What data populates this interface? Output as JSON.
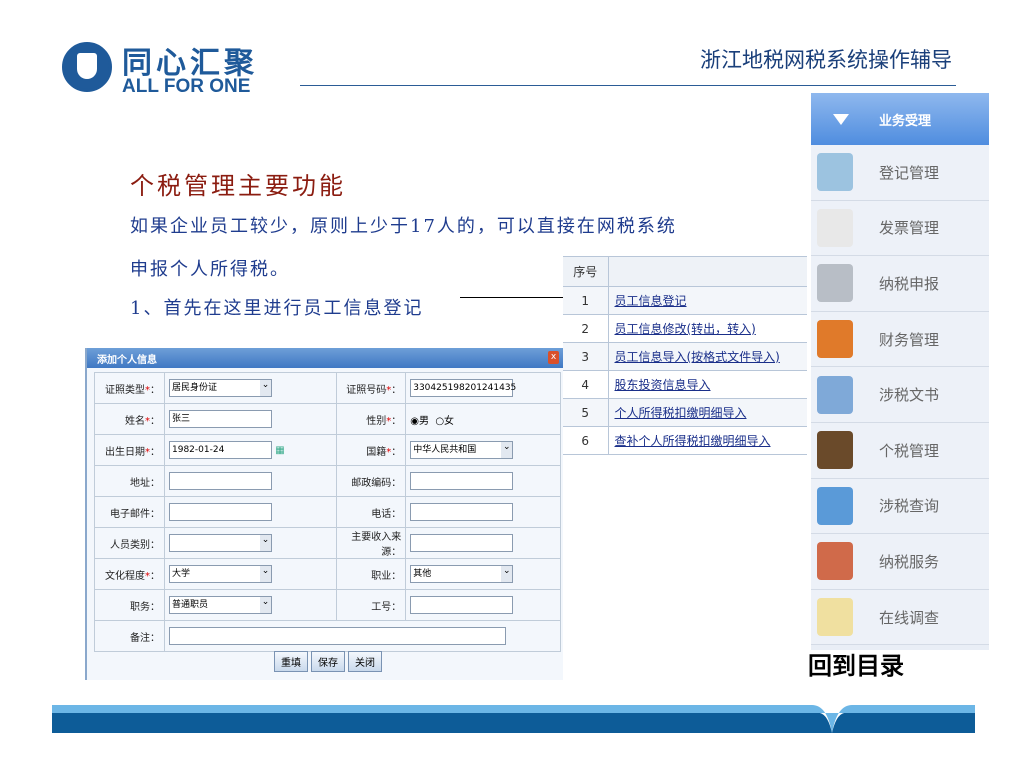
{
  "header": {
    "logo_cn": "同心汇聚",
    "logo_en": "ALL FOR ONE",
    "title": "浙江地税网税系统操作辅导"
  },
  "main": {
    "heading": "个税管理主要功能",
    "lines": [
      "如果企业员工较少，原则上少于17人的，可以直接在网税系统",
      "申报个人所得税。",
      "1、首先在这里进行员工信息登记"
    ]
  },
  "table": {
    "header": "序号",
    "rows": [
      {
        "n": "1",
        "label": "员工信息登记"
      },
      {
        "n": "2",
        "label": "员工信息修改(转出，转入)"
      },
      {
        "n": "3",
        "label": "员工信息导入(按格式文件导入)"
      },
      {
        "n": "4",
        "label": "股东投资信息导入"
      },
      {
        "n": "5",
        "label": "个人所得税扣缴明细导入"
      },
      {
        "n": "6",
        "label": "查补个人所得税扣缴明细导入"
      }
    ]
  },
  "sidebar": {
    "header": "业务受理",
    "items": [
      "登记管理",
      "发票管理",
      "纳税申报",
      "财务管理",
      "涉税文书",
      "个税管理",
      "涉税查询",
      "纳税服务",
      "在线调查"
    ],
    "icon_colors": [
      "#9cc3e0",
      "#e8e8e8",
      "#b8bec6",
      "#e07a2a",
      "#7fa9d8",
      "#6a4a2a",
      "#5a9ad8",
      "#d06a4a",
      "#f0e0a0"
    ]
  },
  "form": {
    "title": "添加个人信息",
    "close": "x",
    "req": "*",
    "id_type_label": "证照类型",
    "id_type": "居民身份证",
    "id_no_label": "证照号码",
    "id_no": "330425198201241435",
    "name_label": "姓名",
    "name": "张三",
    "gender_label": "性别",
    "male": "男",
    "female": "女",
    "birth_label": "出生日期",
    "birth": "1982-01-24",
    "nation_label": "国籍",
    "nation": "中华人民共和国",
    "addr_label": "地址：",
    "zip_label": "邮政编码：",
    "email_label": "电子邮件：",
    "phone_label": "电话：",
    "ptype_label": "人员类别：",
    "income_label": "主要收入来源：",
    "edu_label": "文化程度",
    "edu": "大学",
    "job_label": "职业：",
    "job": "其他",
    "post_label": "职务：",
    "post": "普通职员",
    "empno_label": "工号：",
    "note_label": "备注：",
    "reset": "重填",
    "save": "保存",
    "close_btn": "关闭"
  },
  "footer": {
    "back": "回到目录"
  }
}
